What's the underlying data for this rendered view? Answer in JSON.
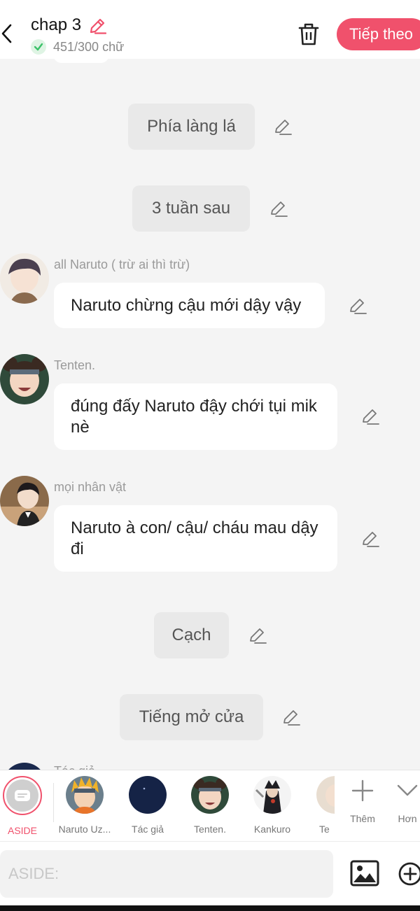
{
  "header": {
    "title": "chap 3",
    "word_count": "451/300 chữ",
    "next_label": "Tiếp theo"
  },
  "messages": [
    {
      "type": "narration",
      "text": "Phía làng lá"
    },
    {
      "type": "narration",
      "text": "3 tuần sau"
    },
    {
      "type": "dialogue",
      "speaker": "all Naruto ( trừ ai thì trừ)",
      "text": "Naruto chừng cậu mới dậy vậy"
    },
    {
      "type": "dialogue",
      "speaker": "Tenten.",
      "text": "đúng đấy Naruto đậy chới tụi mik nè"
    },
    {
      "type": "dialogue",
      "speaker": "mọi nhân vật",
      "text": "Naruto à con/ cậu/ cháu mau dậy đi"
    },
    {
      "type": "narration",
      "text": "Cạch"
    },
    {
      "type": "narration",
      "text": "Tiếng mở cửa"
    },
    {
      "type": "dialogue",
      "speaker": "Tác giả",
      "text": ""
    }
  ],
  "characters": [
    {
      "label": "ASIDE",
      "icon": "aside-icon",
      "selected": true
    },
    {
      "label": "Naruto Uz...",
      "icon": "avatar-naruto"
    },
    {
      "label": "Tác giả",
      "icon": "avatar-author"
    },
    {
      "label": "Tenten.",
      "icon": "avatar-tenten"
    },
    {
      "label": "Kankuro",
      "icon": "avatar-kankuro"
    },
    {
      "label": "Te",
      "icon": "avatar-partial"
    }
  ],
  "tools": {
    "add_label": "Thêm",
    "more_label": "Hơn"
  },
  "input": {
    "placeholder": "ASIDE:",
    "value": ""
  },
  "colors": {
    "accent": "#f0516c",
    "background": "#f4f4f4",
    "bubble": "#ffffff",
    "narration": "#e9e9e9",
    "check_green": "#3cc26a"
  }
}
